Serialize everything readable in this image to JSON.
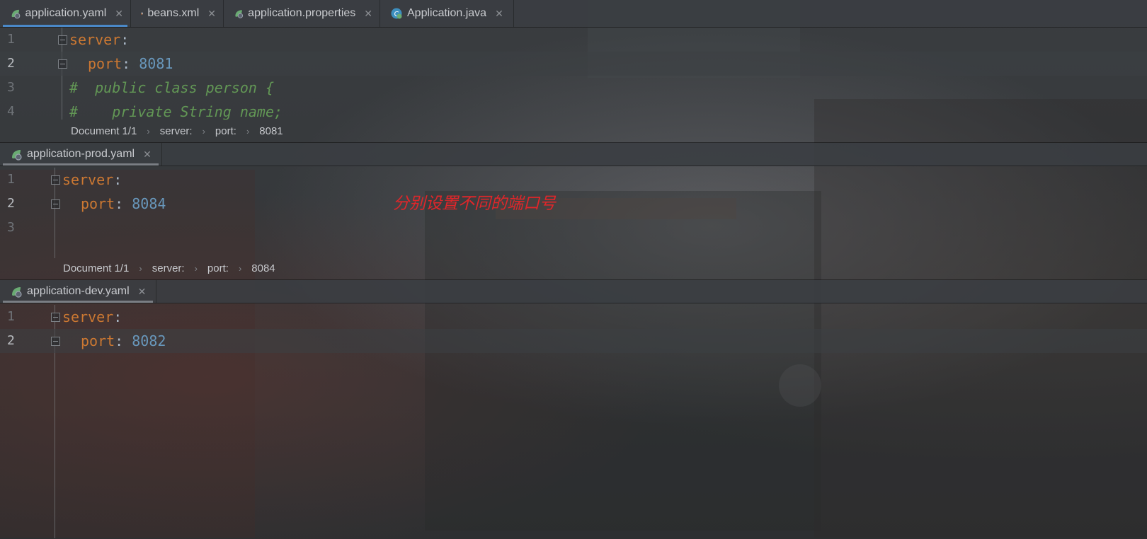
{
  "top_tabs": [
    {
      "label": "application.yaml",
      "icon": "spring-icon",
      "active": true
    },
    {
      "label": "beans.xml",
      "icon": "xml-icon",
      "active": false
    },
    {
      "label": "application.properties",
      "icon": "spring-icon",
      "active": false
    },
    {
      "label": "Application.java",
      "icon": "java-class-icon",
      "active": false
    }
  ],
  "pane1": {
    "lines": [
      {
        "num": "1",
        "indent": "",
        "key": "server",
        "colon": ":",
        "value": ""
      },
      {
        "num": "2",
        "indent": "  ",
        "key": "port",
        "colon": ": ",
        "value": "8081"
      },
      {
        "num": "3",
        "comment": "#  public class person {"
      },
      {
        "num": "4",
        "comment": "#    private String name;"
      }
    ],
    "breadcrumb": [
      "Document 1/1",
      "server:",
      "port:",
      "8081"
    ]
  },
  "pane2": {
    "tab": {
      "label": "application-prod.yaml",
      "icon": "spring-icon"
    },
    "lines": [
      {
        "num": "1",
        "key": "server",
        "colon": ":",
        "value": ""
      },
      {
        "num": "2",
        "key": "port",
        "colon": ": ",
        "value": "8084"
      },
      {
        "num": "3"
      }
    ],
    "breadcrumb": [
      "Document 1/1",
      "server:",
      "port:",
      "8084"
    ]
  },
  "pane3": {
    "tab": {
      "label": "application-dev.yaml",
      "icon": "spring-icon"
    },
    "lines": [
      {
        "num": "1",
        "key": "server",
        "colon": ":",
        "value": ""
      },
      {
        "num": "2",
        "key": "port",
        "colon": ": ",
        "value": "8082"
      }
    ]
  },
  "annotation": "分别设置不同的端口号",
  "colors": {
    "keyword": "#cc7832",
    "number": "#6897bb",
    "comment": "#629755",
    "annotation": "#e0262a",
    "active_tab_underline": "#4a88c7"
  }
}
